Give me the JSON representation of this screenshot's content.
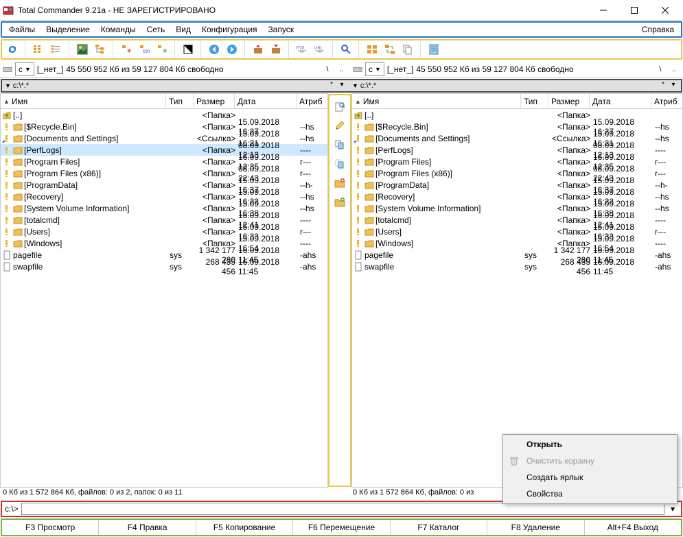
{
  "title": "Total Commander 9.21a - НЕ ЗАРЕГИСТРИРОВАНО",
  "menu": [
    "Файлы",
    "Выделение",
    "Команды",
    "Сеть",
    "Вид",
    "Конфигурация",
    "Запуск"
  ],
  "menu_right": "Справка",
  "drive": {
    "letter": "c",
    "net": "[_нет_]",
    "info": "45 550 952 Кб из 59 127 804 Кб свободно"
  },
  "path_left": "c:\\*.*",
  "path_right": "c:\\*.*",
  "headers": {
    "name": "Имя",
    "type": "Тип",
    "size": "Размер",
    "date": "Дата",
    "attr": "Атриб"
  },
  "files": [
    {
      "icon": "up",
      "name": "[..]",
      "type": "",
      "size": "<Папка>",
      "date": "",
      "attr": ""
    },
    {
      "icon": "warn",
      "name": "[$Recycle.Bin]",
      "type": "",
      "size": "<Папка>",
      "date": "15.09.2018 16:27",
      "attr": "--hs"
    },
    {
      "icon": "link",
      "name": "[Documents and Settings]",
      "type": "",
      "size": "<Ссылка>",
      "date": "15.09.2018 16:21",
      "attr": "--hs"
    },
    {
      "icon": "warn",
      "name": "[PerfLogs]",
      "type": "",
      "size": "<Папка>",
      "date": "08.09.2018 12:13",
      "attr": "----",
      "selected": true
    },
    {
      "icon": "warn",
      "name": "[Program Files]",
      "type": "",
      "size": "<Папка>",
      "date": "16.09.2018 12:35",
      "attr": "r---"
    },
    {
      "icon": "warn",
      "name": "[Program Files (x86)]",
      "type": "",
      "size": "<Папка>",
      "date": "08.09.2018 22:43",
      "attr": "r---"
    },
    {
      "icon": "warn",
      "name": "[ProgramData]",
      "type": "",
      "size": "<Папка>",
      "date": "15.09.2018 16:37",
      "attr": "--h-"
    },
    {
      "icon": "warn",
      "name": "[Recovery]",
      "type": "",
      "size": "<Папка>",
      "date": "15.09.2018 16:22",
      "attr": "--hs"
    },
    {
      "icon": "warn",
      "name": "[System Volume Information]",
      "type": "",
      "size": "<Папка>",
      "date": "15.09.2018 16:38",
      "attr": "--hs"
    },
    {
      "icon": "warn",
      "name": "[totalcmd]",
      "type": "",
      "size": "<Папка>",
      "date": "16.09.2018 12:41",
      "attr": "----"
    },
    {
      "icon": "warn",
      "name": "[Users]",
      "type": "",
      "size": "<Папка>",
      "date": "15.09.2018 16:33",
      "attr": "r---"
    },
    {
      "icon": "warn",
      "name": "[Windows]",
      "type": "",
      "size": "<Папка>",
      "date": "15.09.2018 16:54",
      "attr": "----"
    },
    {
      "icon": "file",
      "name": "pagefile",
      "type": "sys",
      "size": "1 342 177 280",
      "date": "16.09.2018 11:45",
      "attr": "-ahs"
    },
    {
      "icon": "file",
      "name": "swapfile",
      "type": "sys",
      "size": "268 435 456",
      "date": "16.09.2018 11:45",
      "attr": "-ahs"
    }
  ],
  "status_left": "0 Кб из 1 572 864 Кб, файлов: 0 из 2, папок: 0 из 11",
  "status_right": "0 Кб из 1 572 864 Кб, файлов: 0 из",
  "cmd_prompt": "c:\\>",
  "fkeys": [
    "F3 Просмотр",
    "F4 Правка",
    "F5 Копирование",
    "F6 Перемещение",
    "F7 Каталог",
    "F8 Удаление",
    "Alt+F4 Выход"
  ],
  "context": {
    "open": "Открыть",
    "empty": "Очистить корзину",
    "shortcut": "Создать ярлык",
    "props": "Свойства"
  }
}
